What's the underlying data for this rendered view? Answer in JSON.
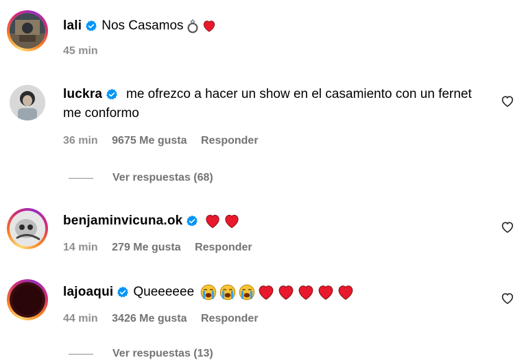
{
  "comments": [
    {
      "username": "lali",
      "text": "Nos Casamos",
      "time": "45 min"
    },
    {
      "username": "luckra",
      "text": "me ofrezco a hacer un show en el casamiento con un fernet me conformo",
      "time": "36 min",
      "likes": "9675 Me gusta",
      "reply": "Responder",
      "view_replies": "Ver respuestas (68)"
    },
    {
      "username": "benjaminvicuna.ok",
      "text": "",
      "time": "14 min",
      "likes": "279 Me gusta",
      "reply": "Responder"
    },
    {
      "username": "lajoaqui",
      "text": "Queeeeee",
      "time": "44 min",
      "likes": "3426 Me gusta",
      "reply": "Responder",
      "view_replies": "Ver respuestas (13)"
    }
  ],
  "colors": {
    "verified": "#0095f6",
    "heart": "#e8192c",
    "muted": "#737373"
  }
}
